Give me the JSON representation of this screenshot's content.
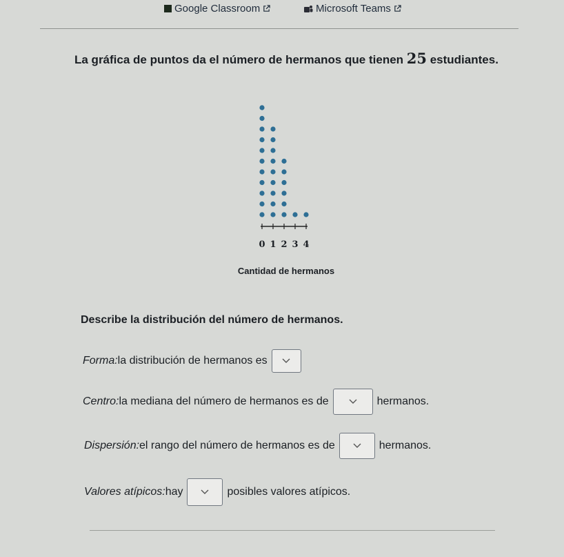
{
  "links": {
    "classroom": "Google Classroom",
    "teams": "Microsoft Teams"
  },
  "intro": {
    "text_before": "La gráfica de puntos da el número de hermanos que tienen ",
    "count": "25",
    "text_after": " estudiantes."
  },
  "chart_data": {
    "type": "dot",
    "categories": [
      0,
      1,
      2,
      3,
      4
    ],
    "values": [
      11,
      9,
      6,
      1,
      1
    ],
    "xlabel": "Cantidad de hermanos",
    "tick_labels": [
      "0",
      "1",
      "2",
      "3",
      "4"
    ],
    "dot_color": "#2e6f95"
  },
  "question": "Describe la distribución del número de hermanos.",
  "rows": {
    "forma": {
      "label": "Forma:",
      "text": " la distribución de hermanos es"
    },
    "centro": {
      "label": "Centro:",
      "text": " la mediana del número de hermanos es de",
      "after": "hermanos."
    },
    "dispersion": {
      "label": "Dispersión:",
      "text": " el rango del número de hermanos es de",
      "after": "hermanos."
    },
    "atipicos": {
      "label": "Valores atípicos:",
      "text": " hay",
      "after": "posibles valores atípicos."
    }
  }
}
